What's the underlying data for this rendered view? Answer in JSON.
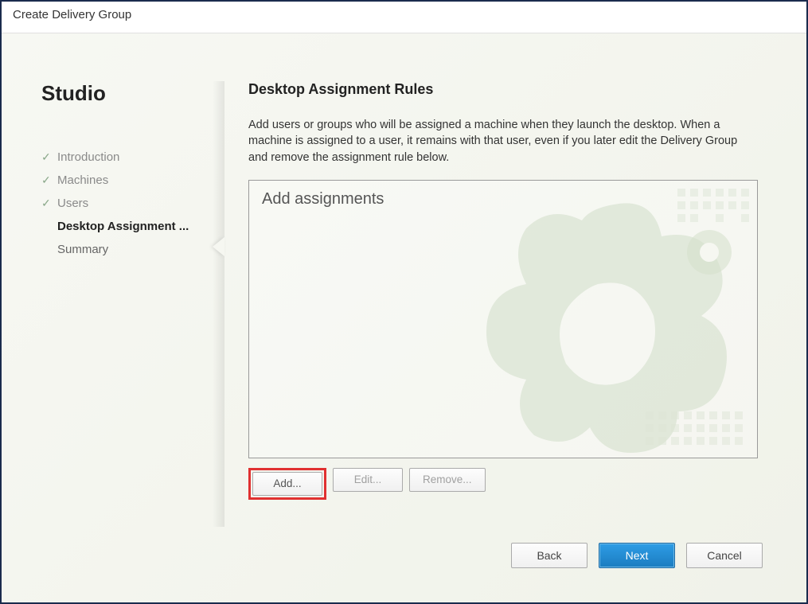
{
  "window": {
    "title": "Create Delivery Group"
  },
  "sidebar": {
    "title": "Studio",
    "steps": [
      {
        "label": "Introduction",
        "state": "done"
      },
      {
        "label": "Machines",
        "state": "done"
      },
      {
        "label": "Users",
        "state": "done"
      },
      {
        "label": "Desktop Assignment ...",
        "state": "current"
      },
      {
        "label": "Summary",
        "state": "pending"
      }
    ]
  },
  "content": {
    "title": "Desktop Assignment Rules",
    "description": "Add users or groups who will be assigned a machine when they launch the desktop. When a machine is assigned to a user, it remains with that user, even if you later edit the Delivery Group and remove the assignment rule below.",
    "list_placeholder": "Add assignments",
    "buttons": {
      "add": "Add...",
      "edit": "Edit...",
      "remove": "Remove..."
    }
  },
  "footer": {
    "back": "Back",
    "next": "Next",
    "cancel": "Cancel"
  }
}
